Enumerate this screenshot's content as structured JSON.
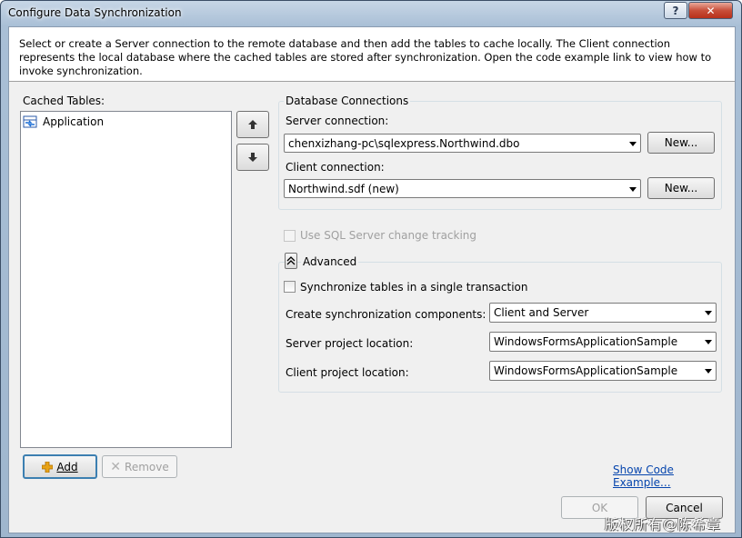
{
  "window": {
    "title": "Configure Data Synchronization",
    "help_label": "?",
    "close_label": "✕"
  },
  "description": "Select or create a Server connection to the remote database and then add the tables to cache locally. The Client connection represents the local database where the cached tables are stored after synchronization. Open the code example link to view how to invoke synchronization.",
  "cached_tables": {
    "label": "Cached Tables:",
    "items": [
      {
        "label": "Application",
        "icon": "table-sync-icon"
      }
    ]
  },
  "move_up_icon": "arrow-up-icon",
  "move_down_icon": "arrow-down-icon",
  "database_connections": {
    "group_label": "Database Connections",
    "server_label": "Server connection:",
    "server_value": "chenxizhang-pc\\sqlexpress.Northwind.dbo",
    "server_new": "New...",
    "client_label": "Client connection:",
    "client_value": "Northwind.sdf (new)",
    "client_new": "New..."
  },
  "use_sql_change_tracking": {
    "label": "Use SQL Server change tracking",
    "checked": false,
    "enabled": false
  },
  "advanced": {
    "toggle_icon": "chevron-up-icon",
    "label": "Advanced",
    "single_transaction": {
      "label": "Synchronize tables in a single transaction",
      "checked": false
    },
    "create_components_label": "Create synchronization components:",
    "create_components_value": "Client and Server",
    "server_project_label": "Server project location:",
    "server_project_value": "WindowsFormsApplicationSample",
    "client_project_label": "Client project location:",
    "client_project_value": "WindowsFormsApplicationSample"
  },
  "buttons": {
    "add": "Add",
    "remove": "Remove",
    "show_code": "Show Code Example...",
    "ok": "OK",
    "cancel": "Cancel"
  },
  "watermark": "版权所有@陈希章",
  "colors": {
    "link": "#0645ad",
    "disabled_text": "#a0a0a0",
    "add_icon": "#e8a317"
  }
}
